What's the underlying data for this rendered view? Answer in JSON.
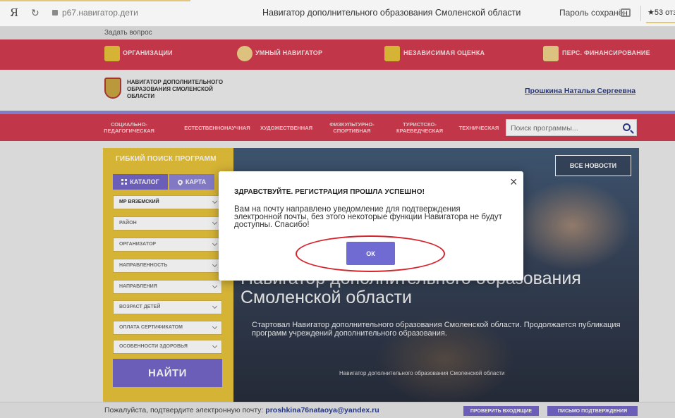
{
  "browser": {
    "yandex_logo": "Я",
    "url": "р67.навигатор.дети",
    "title": "Навигатор дополнительного образования Смоленской области",
    "password_saved": "Пароль сохранён",
    "rating": "★53 отз"
  },
  "site": {
    "ask_link": "Задать вопрос",
    "top_nav": [
      {
        "label": "ОРГАНИЗАЦИИ"
      },
      {
        "label": "УМНЫЙ НАВИГАТОР"
      },
      {
        "label": "НЕЗАВИСИМАЯ ОЦЕНКА"
      },
      {
        "label": "ПЕРС. ФИНАНСИРОВАНИЕ"
      }
    ],
    "org_name": "НАВИГАТОР ДОПОЛНИТЕЛЬНОГО ОБРАЗОВАНИЯ СМОЛЕНСКОЙ ОБЛАСТИ",
    "user_name": "Прошкина Наталья Сергеевна",
    "categories": [
      {
        "label": "СОЦИАЛЬНО-ПЕДАГОГИЧЕСКАЯ"
      },
      {
        "label": "ЕСТЕСТВЕННОНАУЧНАЯ"
      },
      {
        "label": "ХУДОЖЕСТВЕННАЯ"
      },
      {
        "label": "ФИЗКУЛЬТУРНО-СПОРТИВНАЯ"
      },
      {
        "label": "ТУРИСТСКО-КРАЕВЕДЧЕСКАЯ"
      },
      {
        "label": "ТЕХНИЧЕСКАЯ"
      }
    ],
    "search_placeholder": "Поиск программы..."
  },
  "search_panel": {
    "title": "ГИБКИЙ ПОИСК ПРОГРАММ",
    "tab_catalog": "КАТАЛОГ",
    "tab_map": "КАРТА",
    "filters": [
      {
        "label": "МР ВЯЗЕМСКИЙ"
      },
      {
        "label": "РАЙОН"
      },
      {
        "label": "ОРГАНИЗАТОР"
      },
      {
        "label": "НАПРАВЛЕННОСТЬ"
      },
      {
        "label": "НАПРАВЛЕНИЯ"
      },
      {
        "label": "ВОЗРАСТ ДЕТЕЙ"
      },
      {
        "label": "ОПЛАТА СЕРТИФИКАТОМ"
      },
      {
        "label": "ОСОБЕННОСТИ ЗДОРОВЬЯ"
      }
    ],
    "find_button": "НАЙТИ"
  },
  "hero": {
    "news_button": "ВСЕ НОВОСТИ",
    "title": "Навигатор дополнительного образования Смоленской области",
    "text": "Стартовал Навигатор дополнительного образования Смоленской области. Продолжается публикация программ учреждений дополнительного образования.",
    "caption": "Навигатор дополнительного образования Смоленской области"
  },
  "bottom": {
    "confirm_text": "Пожалуйста, подтвердите электронную почту:",
    "email": "proshkina76nataoya@yandex.ru",
    "check_inbox": "ПРОВЕРИТЬ ВХОДЯЩИЕ",
    "resend_letter": "ПИСЬМО ПОДТВЕРЖДЕНИЯ"
  },
  "modal": {
    "close": "×",
    "title": "ЗДРАВСТВУЙТЕ. РЕГИСТРАЦИЯ ПРОШЛА УСПЕШНО!",
    "text": "Вам на почту направлено уведомление для подтверждения электронной почты, без этого некоторые функции Навигатора не будут доступны. Спасибо!",
    "ok_button": "ОК"
  },
  "colors": {
    "nav_red": "#d23c50",
    "accent_purple": "#7466c9",
    "panel_yellow": "#e7c33a",
    "annotation_red": "#d4252e"
  }
}
